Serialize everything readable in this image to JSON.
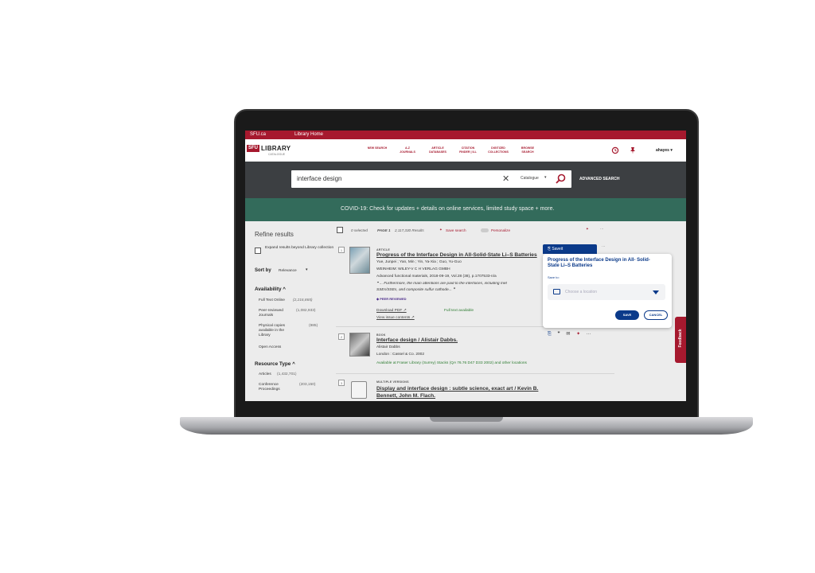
{
  "topbar": {
    "link1": "SFU.ca",
    "link2": "Library Home"
  },
  "logo": {
    "box": "SFU",
    "text": "LIBRARY",
    "sub": "CATALOGUE"
  },
  "nav": {
    "items": [
      {
        "line1": "NEW SEARCH",
        "line2": ""
      },
      {
        "line1": "A-Z",
        "line2": "JOURNALS"
      },
      {
        "line1": "ARTICLE",
        "line2": "DATABASES"
      },
      {
        "line1": "CITATION",
        "line2": "FINDER | ILL"
      },
      {
        "line1": "DIGITIZED",
        "line2": "COLLECTIONS"
      },
      {
        "line1": "BROWSE",
        "line2": "SEARCH"
      }
    ],
    "history_icon": "history-icon",
    "pin_icon": "pin-icon",
    "user": "ahayes ▾"
  },
  "search": {
    "query": "interface design",
    "clear": "✕",
    "scope": "Catalogue",
    "caret": "▾",
    "go": "⚲",
    "advanced": "ADVANCED SEARCH"
  },
  "covid": "COVID-19: Check for updates + details on online services, limited study space + more.",
  "refine": {
    "title": "Refine results",
    "expand": "Expand results beyond Library collection",
    "sort_label": "Sort by",
    "sort_value": "Relevance",
    "sort_caret": "▾",
    "availability": "Availability ^",
    "avail_items": [
      {
        "label": "Full Text Online",
        "count": "(2,216,865)"
      },
      {
        "label": "Peer-reviewed Journals",
        "count": "(1,082,933)"
      },
      {
        "label": "Physical copies available in the Library",
        "count": "(985)"
      },
      {
        "label": "Open Access",
        "count": ""
      }
    ],
    "resource_type": "Resource Type ^",
    "rt_items": [
      {
        "label": "Articles",
        "count": "(1,432,701)"
      },
      {
        "label": "Conference Proceedings",
        "count": "(203,150)"
      }
    ]
  },
  "results_meta": {
    "selected": "0 selected",
    "page": "PAGE 1",
    "count": "2,117,330 Results",
    "save_search": "Save search",
    "personalize": "Personalize",
    "more": "···"
  },
  "results": [
    {
      "index": "1",
      "type": "ARTICLE",
      "title": "Progress of the Interface Design in All-Solid-State Li–S Batteries",
      "authors": "Yue, Junpei ; Yan, Min ; Yin, Ya-Xia ; Guo, Yu-Guo",
      "publisher": "WEINHEIM: WILEY-V C H VERLAG GMBH",
      "source": "Advanced functional materials, 2018-09-19, Vol.28 (38), p.1707533-n/a",
      "snippet1": "❝ ... Furthermore, the main attentions are paid to the interfaces, including met",
      "snippet2": "SSEs/SSEs, and composite sulfur cathode... ❞",
      "peer": "PEER REVIEWED",
      "download": "Download PDF ↗",
      "fulltext": "Full text available",
      "issue": "View issue contents ↗"
    },
    {
      "index": "2",
      "type": "BOOK",
      "title": "Interface design / Alistair Dabbs.",
      "authors": "Alistair Dabbs",
      "publisher": "London : Cassel & Co. 2002",
      "availability": "Available at Fraser Library (Surrey)  Stacks (QA 76.76 D47 D33 2002) and other locations"
    },
    {
      "index": "3",
      "type": "MULTIPLE VERSIONS",
      "title": "Display and interface design : subtle science, exact art / Kevin B. Bennett, John M. Flach."
    }
  ],
  "popup": {
    "tab": "Saveit",
    "title": "Progress of the Interface Design in All- Solid-State Li–S Batteries",
    "save_to": "Save to:",
    "placeholder": "Choose a location",
    "save": "SAVE",
    "cancel": "CANCEL"
  },
  "feedback": "Feedback",
  "colors": {
    "brand": "#a6192e",
    "covid": "#336b5b",
    "popup": "#0b3a8a",
    "search_band": "#3c3f42"
  }
}
